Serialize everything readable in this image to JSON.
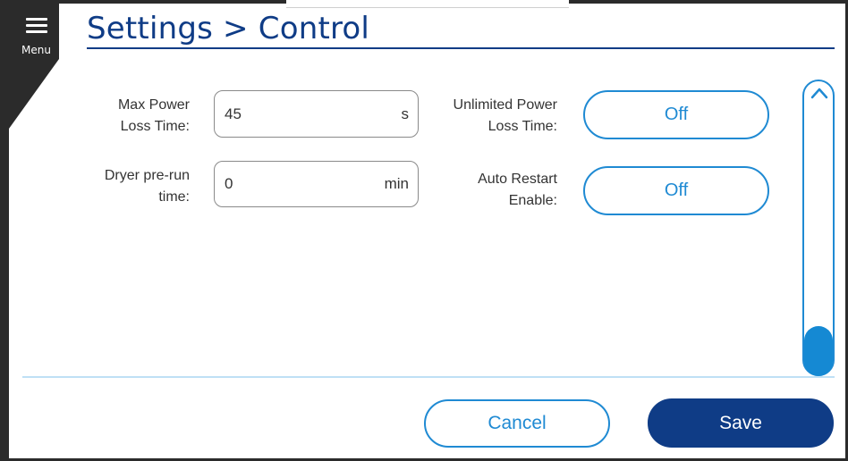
{
  "header": {
    "menu_label": "Menu",
    "title": "Settings > Control"
  },
  "left_fields": [
    {
      "label_line1": "Max Power",
      "label_line2": "Loss Time:",
      "value": "45",
      "unit": "s"
    },
    {
      "label_line1": "Dryer pre-run",
      "label_line2": "time:",
      "value": "0",
      "unit": "min"
    }
  ],
  "right_fields": [
    {
      "label_line1": "Unlimited Power",
      "label_line2": "Loss Time:",
      "value": "Off"
    },
    {
      "label_line1": "Auto Restart",
      "label_line2": "Enable:",
      "value": "Off"
    }
  ],
  "footer": {
    "cancel_label": "Cancel",
    "save_label": "Save"
  },
  "colors": {
    "primary_dark": "#0f3c86",
    "accent": "#1f8ad3",
    "frame": "#2b2b2b"
  },
  "icons": [
    "hamburger-menu-icon",
    "chevron-up-icon"
  ]
}
